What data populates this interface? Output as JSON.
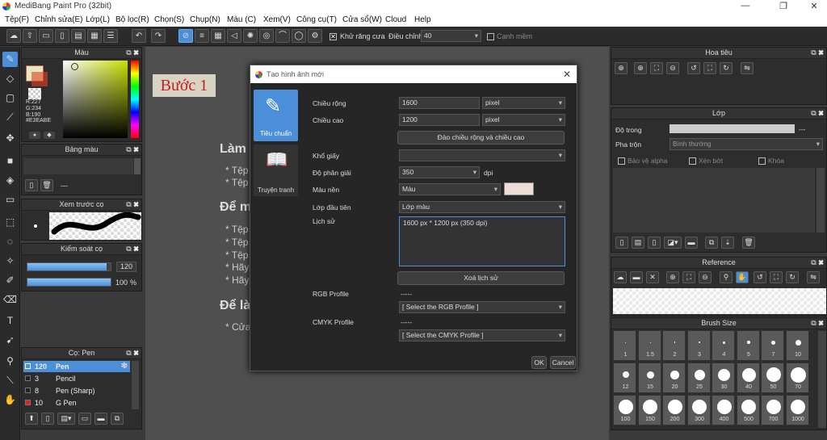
{
  "window": {
    "title": "MediBang Paint Pro (32bit)",
    "minimize": "—",
    "maximize": "❐",
    "close": "✕"
  },
  "menu": [
    "Tệp(F)",
    "Chỉnh sửa(E)",
    "Lớp(L)",
    "Bộ lọc(R)",
    "Chọn(S)",
    "Chụp(N)",
    "Màu (C)",
    "Xem(V)",
    "Công cụ(T)",
    "Cửa sổ(W)",
    "Cloud",
    "Help"
  ],
  "toolbar": {
    "antialias_label": "Khử răng cưa",
    "antialias_checked": "✕",
    "adjust_label": "Điều chỉnh",
    "adjust_value": "40",
    "edge_label": "Cạnh mềm"
  },
  "color_panel": {
    "title": "Màu",
    "r": "R:227",
    "g": "G:234",
    "b": "B:190",
    "hex": "#E3EABE"
  },
  "palette_panel": {
    "title": "Bảng màu",
    "dashes": "---"
  },
  "brush_preview": {
    "title": "Xem trước cọ"
  },
  "brush_control": {
    "title": "Kiểm soát cọ",
    "size": "120",
    "opacity": "100",
    "opacity_unit": "%",
    "size_fill": 0.95,
    "opacity_fill": 1.0
  },
  "brush_list": {
    "title": "Cọ: Pen",
    "items": [
      {
        "size": "120",
        "name": "Pen",
        "color": "#4a8fd8"
      },
      {
        "size": "3",
        "name": "Pencil",
        "color": "#222"
      },
      {
        "size": "8",
        "name": "Pen (Sharp)",
        "color": "#222"
      },
      {
        "size": "10",
        "name": "G Pen",
        "color": "#e02020"
      }
    ]
  },
  "canvas": {
    "step_label": "Bước 1",
    "heading1": "Làm",
    "bullet1": "* Tệp",
    "bullet2": "* Tệp",
    "heading2": "Để m",
    "b3": "* Tệp",
    "b4": "* Tệp",
    "b5": "* Tệp",
    "b6": "* Hãy",
    "b7": "* Hãy",
    "heading3": "Để là",
    "b8": "* Cửa"
  },
  "dialog": {
    "title": "Tạo hình ảnh mới",
    "close": "✕",
    "tab_standard": "Tiêu chuẩn",
    "tab_comic": "Truyện tranh",
    "width_label": "Chiều rộng",
    "width_value": "1600",
    "width_unit": "pixel",
    "height_label": "Chiều cao",
    "height_value": "1200",
    "height_unit": "pixel",
    "swap_button": "Đảo chiều rộng và chiều cao",
    "paper_label": "Khổ giấy",
    "paper_value": "",
    "res_label": "Độ phân giải",
    "res_value": "350",
    "res_unit": "dpi",
    "bg_label": "Màu nền",
    "bg_value": "Màu",
    "bg_color": "#f0dcd6",
    "first_layer_label": "Lớp đầu tiên",
    "first_layer_value": "Lớp màu",
    "history_label": "Lịch sử",
    "history_value": "1600 px * 1200 px (350 dpi)",
    "clear_history": "Xoá lịch sử",
    "rgb_label": "RGB Profile",
    "rgb_dash": "-----",
    "rgb_select": "[ Select the RGB Profile ]",
    "cmyk_label": "CMYK Profile",
    "cmyk_dash": "-----",
    "cmyk_select": "[ Select the CMYK Profile ]",
    "ok": "OK",
    "cancel": "Cancel"
  },
  "navigator": {
    "title": "Hoa tiêu"
  },
  "layers": {
    "title": "Lớp",
    "opacity_label": "Độ trong",
    "opacity_dash": "---",
    "blend_label": "Pha trộn",
    "blend_value": "Bình thường",
    "protect_alpha": "Bảo vệ alpha",
    "clip": "Xén bớt",
    "lock": "Khóa"
  },
  "reference": {
    "title": "Reference"
  },
  "brush_size": {
    "title": "Brush Size",
    "row1": [
      "1",
      "1.5",
      "2",
      "3",
      "4",
      "5",
      "7",
      "10"
    ],
    "row2": [
      "12",
      "15",
      "20",
      "25",
      "30",
      "40",
      "50",
      "70"
    ],
    "row3": [
      "100",
      "150",
      "200",
      "300",
      "400",
      "500",
      "700",
      "1000"
    ]
  },
  "colors": {
    "accent": "#4a8fd8",
    "fg": "#e3eabe",
    "step_bg": "#d8d3c2",
    "step_text": "#c02020"
  }
}
